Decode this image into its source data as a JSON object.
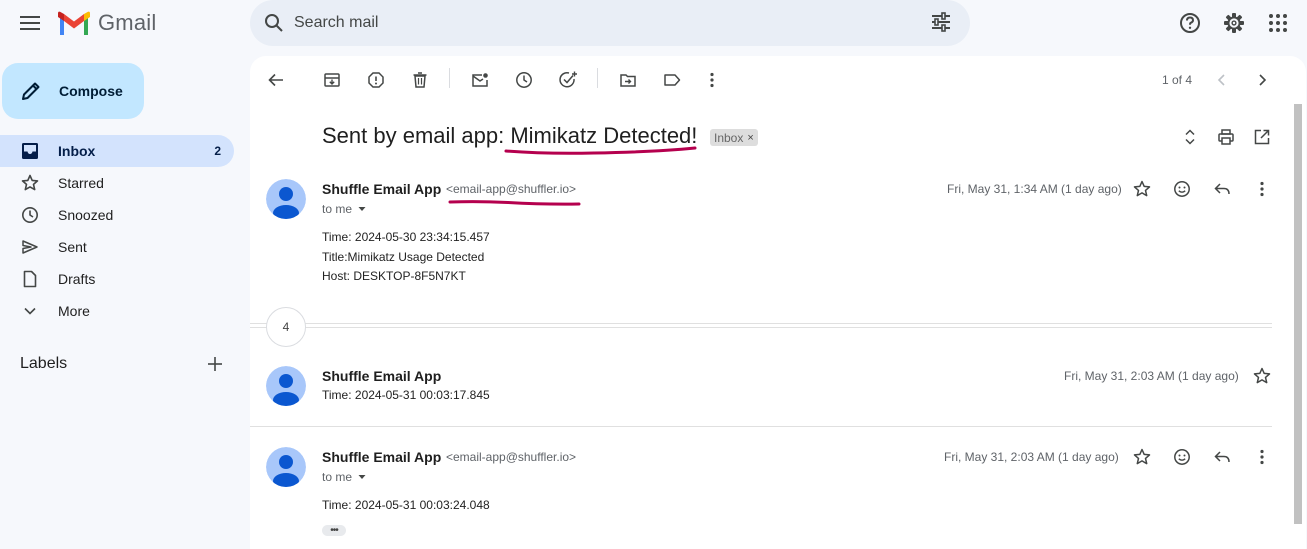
{
  "app": {
    "name": "Gmail"
  },
  "search": {
    "placeholder": "Search mail"
  },
  "sidebar": {
    "compose_label": "Compose",
    "items": [
      {
        "label": "Inbox",
        "count": "2",
        "icon": "inbox-icon"
      },
      {
        "label": "Starred",
        "icon": "star-icon"
      },
      {
        "label": "Snoozed",
        "icon": "clock-icon"
      },
      {
        "label": "Sent",
        "icon": "send-icon"
      },
      {
        "label": "Drafts",
        "icon": "draft-icon"
      },
      {
        "label": "More",
        "icon": "chevron-down-icon"
      }
    ],
    "labels_title": "Labels"
  },
  "toolbar": {
    "page_count": "1 of 4"
  },
  "thread": {
    "subject_prefix": "Sent by email app: ",
    "subject_highlight": "Mimikatz Detected",
    "subject_suffix": "!",
    "label_chip": "Inbox",
    "collapsed_count": "4",
    "messages": [
      {
        "sender": "Shuffle Email App",
        "email": "<email-app@shuffler.io>",
        "to": "to me",
        "date": "Fri, May 31, 1:34 AM (1 day ago)",
        "lines": [
          "Time: 2024-05-30 23:34:15.457",
          "Title:Mimikatz Usage Detected",
          "Host: DESKTOP-8F5N7KT"
        ]
      },
      {
        "sender": "Shuffle Email App",
        "snippet": "Time: 2024-05-31 00:03:17.845",
        "date": "Fri, May 31, 2:03 AM (1 day ago)"
      },
      {
        "sender": "Shuffle Email App",
        "email": "<email-app@shuffler.io>",
        "to": "to me",
        "date": "Fri, May 31, 2:03 AM (1 day ago)",
        "lines": [
          "Time: 2024-05-31 00:03:24.048"
        ]
      }
    ]
  },
  "colors": {
    "accent": "#c2e7ff",
    "active_nav": "#d3e3fd",
    "annotation": "#b5004e"
  }
}
